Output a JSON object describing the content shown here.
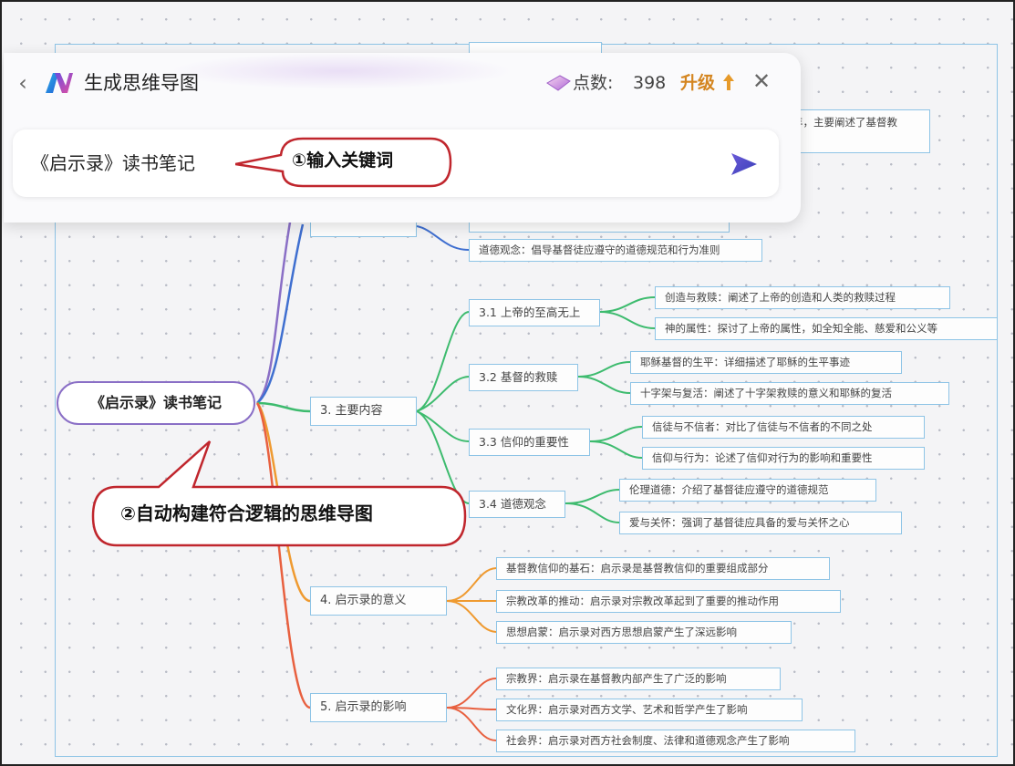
{
  "panel": {
    "title": "生成思维导图",
    "points_label": "点数:",
    "points_value": "398",
    "upgrade_label": "升级",
    "input_value": "《启示录》读书笔记"
  },
  "callouts": {
    "step1": "①输入关键词",
    "step2": "②自动构建符合逻辑的思维导图"
  },
  "mindmap": {
    "root": "《启示录》读书笔记",
    "partial_top_text": "年，主要阐述了基督教",
    "partial_ethics": "道德观念：倡导基督徒应遵守的道德规范和行为准则",
    "main_content": {
      "label": "3. 主要内容",
      "subs": [
        {
          "label": "3.1 上帝的至高无上",
          "leaves": [
            "创造与救赎：阐述了上帝的创造和人类的救赎过程",
            "神的属性：探讨了上帝的属性，如全知全能、慈爱和公义等"
          ]
        },
        {
          "label": "3.2 基督的救赎",
          "leaves": [
            "耶稣基督的生平：详细描述了耶稣的生平事迹",
            "十字架与复活：阐述了十字架救赎的意义和耶稣的复活"
          ]
        },
        {
          "label": "3.3 信仰的重要性",
          "leaves": [
            "信徒与不信者：对比了信徒与不信者的不同之处",
            "信仰与行为：论述了信仰对行为的影响和重要性"
          ]
        },
        {
          "label": "3.4 道德观念",
          "leaves": [
            "伦理道德：介绍了基督徒应遵守的道德规范",
            "爱与关怀：强调了基督徒应具备的爱与关怀之心"
          ]
        }
      ]
    },
    "significance": {
      "label": "4. 启示录的意义",
      "leaves": [
        "基督教信仰的基石：启示录是基督教信仰的重要组成部分",
        "宗教改革的推动：启示录对宗教改革起到了重要的推动作用",
        "思想启蒙：启示录对西方思想启蒙产生了深远影响"
      ]
    },
    "influence": {
      "label": "5. 启示录的影响",
      "leaves": [
        "宗教界：启示录在基督教内部产生了广泛的影响",
        "文化界：启示录对西方文学、艺术和哲学产生了影响",
        "社会界：启示录对西方社会制度、法律和道德观念产生了影响"
      ]
    }
  },
  "colors": {
    "purple": "#8a6fc6",
    "blue": "#3f6fd0",
    "green": "#3dbb6e",
    "orange": "#ef9a30",
    "red": "#e8603f",
    "upgrade": "#d4851f",
    "callout_border": "#c0262d"
  }
}
